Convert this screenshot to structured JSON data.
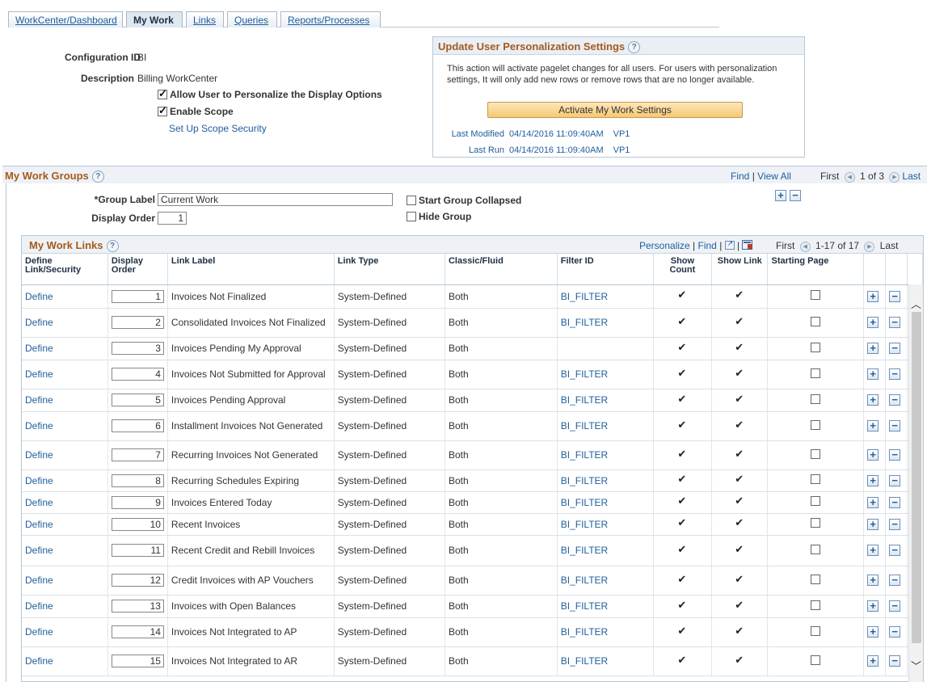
{
  "tabs": [
    {
      "label": "WorkCenter/Dashboard",
      "active": false
    },
    {
      "label": "My Work",
      "active": true
    },
    {
      "label": "Links",
      "active": false
    },
    {
      "label": "Queries",
      "active": false
    },
    {
      "label": "Reports/Processes",
      "active": false
    }
  ],
  "config": {
    "config_id_label": "Configuration ID",
    "config_id_value": "BI",
    "description_label": "Description",
    "description_value": "Billing WorkCenter",
    "allow_personalize_label": "Allow User to Personalize the Display Options",
    "allow_personalize_checked": true,
    "enable_scope_label": "Enable Scope",
    "enable_scope_checked": true,
    "scope_security_link": "Set Up Scope Security"
  },
  "personalization": {
    "title": "Update User Personalization Settings",
    "help": "?",
    "text": "This action will activate pagelet changes for all users.  For users with personalization settings, It will only add new rows or remove rows that are no longer available.",
    "button": "Activate My Work Settings",
    "last_modified_label": "Last Modified",
    "last_modified_value": "04/14/2016 11:09:40AM",
    "last_modified_user": "VP1",
    "last_run_label": "Last Run",
    "last_run_value": "04/14/2016 11:09:40AM",
    "last_run_user": "VP1"
  },
  "groups": {
    "title": "My Work Groups",
    "help": "?",
    "find": "Find",
    "sep": "|",
    "view_all": "View All",
    "first": "First",
    "range": "1 of 3",
    "last": "Last",
    "group_label_label": "*Group Label",
    "group_label_value": "Current Work",
    "display_order_label": "Display Order",
    "display_order_value": "1",
    "start_collapsed_label": "Start Group Collapsed",
    "hide_group_label": "Hide Group",
    "add": "+",
    "remove": "−"
  },
  "links": {
    "title": "My Work Links",
    "help": "?",
    "personalize": "Personalize",
    "sep": "|",
    "find": "Find",
    "first": "First",
    "range": "1-17 of 17",
    "last": "Last",
    "columns": [
      "Define Link/Security",
      "Display Order",
      "Link Label",
      "Link Type",
      "Classic/Fluid",
      "Filter ID",
      "Show Count",
      "Show Link",
      "Starting Page"
    ],
    "rows": [
      {
        "define": "Define",
        "order": "1",
        "label": "Invoices Not Finalized",
        "type": "System-Defined",
        "cf": "Both",
        "filter": "BI_FILTER"
      },
      {
        "define": "Define",
        "order": "2",
        "label": "Consolidated Invoices Not Finalized",
        "type": "System-Defined",
        "cf": "Both",
        "filter": "BI_FILTER"
      },
      {
        "define": "Define",
        "order": "3",
        "label": "Invoices Pending My Approval",
        "type": "System-Defined",
        "cf": "Both",
        "filter": ""
      },
      {
        "define": "Define",
        "order": "4",
        "label": "Invoices Not Submitted for Approval",
        "type": "System-Defined",
        "cf": "Both",
        "filter": "BI_FILTER"
      },
      {
        "define": "Define",
        "order": "5",
        "label": "Invoices Pending Approval",
        "type": "System-Defined",
        "cf": "Both",
        "filter": "BI_FILTER"
      },
      {
        "define": "Define",
        "order": "6",
        "label": "Installment Invoices Not Generated",
        "type": "System-Defined",
        "cf": "Both",
        "filter": "BI_FILTER"
      },
      {
        "define": "Define",
        "order": "7",
        "label": "Recurring Invoices Not Generated",
        "type": "System-Defined",
        "cf": "Both",
        "filter": "BI_FILTER"
      },
      {
        "define": "Define",
        "order": "8",
        "label": "Recurring Schedules Expiring",
        "type": "System-Defined",
        "cf": "Both",
        "filter": "BI_FILTER"
      },
      {
        "define": "Define",
        "order": "9",
        "label": "Invoices Entered Today",
        "type": "System-Defined",
        "cf": "Both",
        "filter": "BI_FILTER"
      },
      {
        "define": "Define",
        "order": "10",
        "label": "Recent Invoices",
        "type": "System-Defined",
        "cf": "Both",
        "filter": "BI_FILTER"
      },
      {
        "define": "Define",
        "order": "11",
        "label": "Recent Credit and Rebill Invoices",
        "type": "System-Defined",
        "cf": "Both",
        "filter": "BI_FILTER"
      },
      {
        "define": "Define",
        "order": "12",
        "label": "Credit Invoices with AP Vouchers",
        "type": "System-Defined",
        "cf": "Both",
        "filter": "BI_FILTER"
      },
      {
        "define": "Define",
        "order": "13",
        "label": "Invoices with Open Balances",
        "type": "System-Defined",
        "cf": "Both",
        "filter": "BI_FILTER"
      },
      {
        "define": "Define",
        "order": "14",
        "label": "Invoices Not Integrated to AP",
        "type": "System-Defined",
        "cf": "Both",
        "filter": "BI_FILTER"
      },
      {
        "define": "Define",
        "order": "15",
        "label": "Invoices Not Integrated to AR",
        "type": "System-Defined",
        "cf": "Both",
        "filter": "BI_FILTER"
      }
    ]
  }
}
